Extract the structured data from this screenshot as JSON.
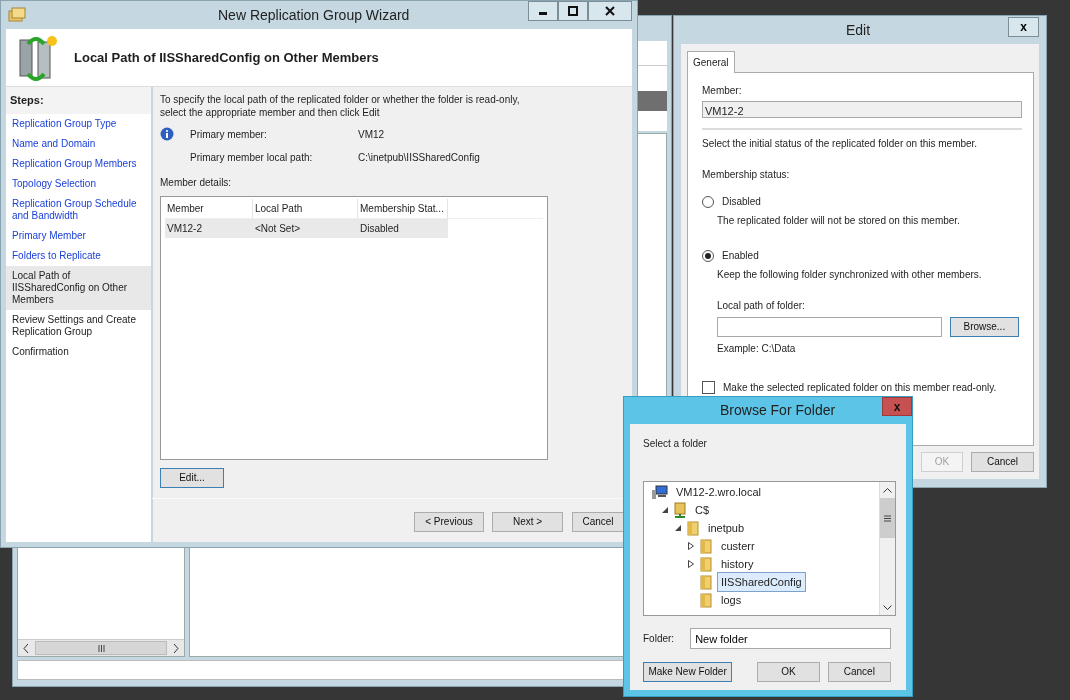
{
  "wizard": {
    "title": "New Replication Group Wizard",
    "header_title": "Local Path of IISSharedConfig on Other Members",
    "steps_label": "Steps:",
    "steps": [
      {
        "label": "Replication Group Type",
        "visited": true,
        "selected": false
      },
      {
        "label": "Name and Domain",
        "visited": true,
        "selected": false
      },
      {
        "label": "Replication Group Members",
        "visited": true,
        "selected": false
      },
      {
        "label": "Topology Selection",
        "visited": true,
        "selected": false
      },
      {
        "label": "Replication Group Schedule and Bandwidth",
        "visited": true,
        "selected": false
      },
      {
        "label": "Primary Member",
        "visited": true,
        "selected": false
      },
      {
        "label": "Folders to Replicate",
        "visited": true,
        "selected": false
      },
      {
        "label": "Local Path of IISSharedConfig on Other Members",
        "visited": false,
        "selected": true
      },
      {
        "label": "Review Settings and Create Replication Group",
        "visited": false,
        "selected": false
      },
      {
        "label": "Confirmation",
        "visited": false,
        "selected": false
      }
    ],
    "instructions": "To specify the local path of the replicated folder or whether the folder is read-only, select the appropriate member and then click Edit",
    "info": [
      {
        "label": "Primary member:",
        "value": "VM12"
      },
      {
        "label": "Primary member local path:",
        "value": "C:\\inetpub\\IISSharedConfig"
      }
    ],
    "member_details_label": "Member details:",
    "table": {
      "columns": [
        "Member",
        "Local Path",
        "Membership Stat..."
      ],
      "rows": [
        {
          "cells": [
            "VM12-2",
            "<Not Set>",
            "Disabled"
          ],
          "selected": true
        }
      ]
    },
    "edit_button": "Edit...",
    "buttons": [
      "< Previous",
      "Next >",
      "Cancel"
    ]
  },
  "edit_dialog": {
    "title": "Edit",
    "close": "x",
    "tabs": [
      {
        "label": "General",
        "selected": true
      }
    ],
    "member_label": "Member:",
    "member_value": "VM12-2",
    "intro": "Select the initial status of the replicated folder on this member.",
    "membership_label": "Membership status:",
    "options": [
      {
        "label": "Disabled",
        "description": "The replicated folder will not be stored on this member.",
        "selected": false
      },
      {
        "label": "Enabled",
        "description": "Keep the following folder synchronized with other members.",
        "selected": true
      }
    ],
    "local_path_label": "Local path of folder:",
    "browse_button": "Browse...",
    "example": "Example: C:\\Data",
    "read_only": {
      "label": "Make the selected replicated folder on this member read-only.",
      "checked": false
    },
    "buttons": [
      {
        "label": "OK",
        "disabled": true
      },
      {
        "label": "Cancel",
        "disabled": false
      }
    ]
  },
  "browse_dialog": {
    "title": "Browse For Folder",
    "close": "x",
    "prompt": "Select a folder",
    "tree": [
      {
        "label": "VM12-2.wro.local",
        "kind": "computer",
        "selected": false,
        "children": [
          {
            "label": "C$",
            "kind": "share",
            "expanded": true,
            "selected": false,
            "children": [
              {
                "label": "inetpub",
                "kind": "folder",
                "expanded": true,
                "selected": false,
                "children": [
                  {
                    "label": "custerr",
                    "kind": "folder",
                    "expanded": false,
                    "selected": false
                  },
                  {
                    "label": "history",
                    "kind": "folder",
                    "expanded": false,
                    "selected": false
                  },
                  {
                    "label": "IISSharedConfig",
                    "kind": "folder",
                    "selected": true
                  },
                  {
                    "label": "logs",
                    "kind": "folder",
                    "selected": false
                  }
                ]
              }
            ]
          }
        ]
      }
    ],
    "folder_label": "Folder:",
    "folder_value": "New folder",
    "buttons": [
      "Make New Folder",
      "OK",
      "Cancel"
    ]
  }
}
